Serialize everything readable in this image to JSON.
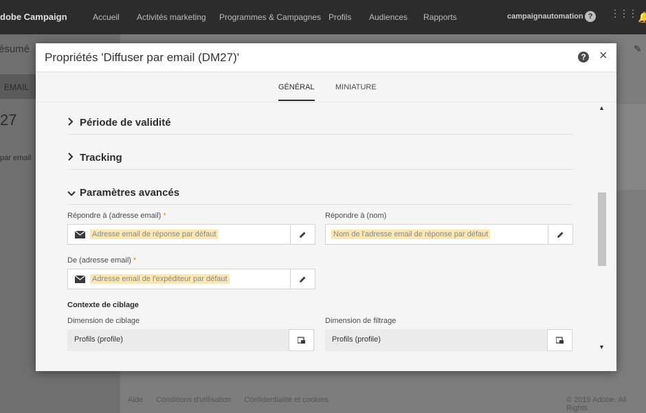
{
  "app": {
    "brand": "dobe Campaign",
    "nav": [
      "Accueil",
      "Activités marketing",
      "Programmes & Campagnes",
      "Profils",
      "Audiences",
      "Rapports"
    ],
    "user": "campaignautomation"
  },
  "background": {
    "page_title": "ésumé",
    "tab_label": "EMAIL",
    "number": "27",
    "label": "par email",
    "footer_links": [
      "Aide",
      "Conditions d'utilisation",
      "Confidentialité et cookies"
    ],
    "copyright": "© 2019 Adobe. All Rights"
  },
  "modal": {
    "title": "Propriétés 'Diffuser par email (DM27)'",
    "help": "?",
    "close": "×",
    "tabs": [
      {
        "label": "GÉNÉRAL",
        "active": true
      },
      {
        "label": "MINIATURE",
        "active": false
      }
    ],
    "sections": [
      {
        "title": "Période de validité",
        "expanded": false,
        "chevron": ">"
      },
      {
        "title": "Tracking",
        "expanded": false,
        "chevron": ">"
      },
      {
        "title": "Paramètres avancés",
        "expanded": true,
        "chevron": "v"
      }
    ],
    "fields": {
      "reply_email": {
        "label": "Répondre à (adresse email)",
        "required": "*",
        "placeholder": "Adresse email de réponse par défaut"
      },
      "reply_name": {
        "label": "Répondre à (nom)",
        "placeholder": "Nom de l'adresse email de réponse par défaut"
      },
      "from_email": {
        "label": "De (adresse email)",
        "required": "*",
        "placeholder": "Adresse email de l'expéditeur par défaut"
      }
    },
    "targeting": {
      "heading": "Contexte de ciblage",
      "targeting_dimension": {
        "label": "Dimension de ciblage",
        "value": "Profils (profile)"
      },
      "filter_dimension": {
        "label": "Dimension de filtrage",
        "value": "Profils (profile)"
      }
    }
  },
  "colors": {
    "topbar": "#2c2c2c",
    "placeholder_highlight": "#fbe7b2",
    "required": "#e68619"
  }
}
